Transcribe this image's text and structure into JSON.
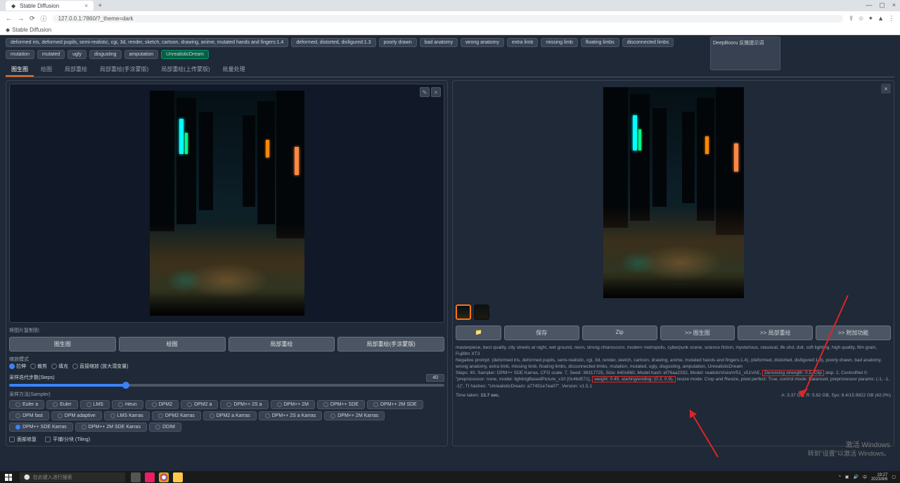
{
  "browser": {
    "tab_title": "Stable Diffusion",
    "url": "127.0.0.1:7860/?_theme=dark",
    "bookmark": "Stable Diffusion"
  },
  "deepbooru_label": "DeepBooru 反推提示词",
  "negative_chips_row1": [
    "deformed iris, deformed pupils, semi-realistic, cgi, 3d, render, sketch, cartoon, drawing, anime, mutated hands and fingers:1.4",
    "deformed, distorted, disfigured:1.3",
    "poorly drawn",
    "bad anatomy",
    "wrong anatomy",
    "extra limb",
    "missing limb",
    "floating limbs",
    "disconnected limbs"
  ],
  "negative_chips_row2": [
    "mutation",
    "mutated",
    "ugly",
    "disgusting",
    "amputation",
    "UnrealisticDream"
  ],
  "sub_tabs": [
    "图生图",
    "绘图",
    "局部重绘",
    "局部重绘(手涂蒙版)",
    "局部重绘(上传蒙版)",
    "批量处理"
  ],
  "left": {
    "copy_label": "将图片复制到:",
    "action_btns": [
      "图生图",
      "绘图",
      "局部重绘",
      "局部重绘(手涂蒙版)"
    ],
    "scale_label": "缩放模式",
    "scale_options": [
      "拉伸",
      "裁剪",
      "填充",
      "直接缩放 (放大潜变量)"
    ],
    "steps_label": "采样迭代步数(Steps)",
    "steps_value": "40",
    "sampler_label": "采样方法(Sampler)",
    "samplers": [
      "Euler a",
      "Euler",
      "LMS",
      "Heun",
      "DPM2",
      "DPM2 a",
      "DPM++ 2S a",
      "DPM++ 2M",
      "DPM++ SDE",
      "DPM++ 2M SDE",
      "DPM fast",
      "DPM adaptive",
      "LMS Karras",
      "DPM2 Karras",
      "DPM2 a Karras",
      "DPM++ 2S a Karras",
      "DPM++ 2M Karras",
      "DPM++ SDE Karras",
      "DPM++ 2M SDE Karras",
      "DDIM"
    ],
    "selected_sampler": "DPM++ SDE Karras",
    "check1": "面部修复",
    "check2": "平铺/分块 (Tiling)"
  },
  "right": {
    "btns": [
      "📁",
      "保存",
      "Zip",
      ">> 图生图",
      ">> 局部重绘",
      ">> 附加功能"
    ],
    "prompt": "masterpiece, best quality, city streets at night, wet ground, neon, strong chiaroscuro, modern metropolis, cyberpunk scene, science fiction, mysterious, classical, 8k uhd, dslr, soft lighting, high quality, film grain, Fujifilm XT3",
    "neg_prompt_label": "Negative prompt:",
    "neg_prompt": "(deformed iris, deformed pupils, semi-realistic, cgi, 3d, render, sketch, cartoon, drawing, anime, mutated hands and fingers:1.4), (deformed, distorted, disfigured:1.3), poorly drawn, bad anatomy, wrong anatomy, extra limb, missing limb, floating limbs, disconnected limbs, mutation, mutated, ugly, disgusting, amputation, UnrealisticDream",
    "params_before_hl1": "Steps: 40, Sampler: DPM++ SDE Karras, CFG scale: 7, Seed: 38317725, Size: 640x960, Model hash: ef76aa2332, Model: realisticVisionV51_v51VAE, ",
    "hl1": "Denoising strength: 0.5, Clip",
    "params_mid": " skip: 2, ControlNet 0: \"preprocessor: none, model: lightingBasedPicture_v10 [0c4bd571], ",
    "hl2": "weight: 0.45, starting/ending: (0.2, 0.9),",
    "params_after": " resize mode: Crop and Resize, pixel perfect: True, control mode: Balanced, preprocessor params: (-1, -1, -1)\", TI hashes: \"UnrealisticDream: a77451e7ea07\", Version: v1.5.1",
    "time_label": "Time taken:",
    "time_value": "13.7 sec.",
    "mem_info": "A: 3.37 GB, R: 5.62 GB, Sys: 6.4/15.9922 GB (42.0%)"
  },
  "watermark": {
    "line1": "激活 Windows",
    "line2": "转到\"设置\"以激活 Windows。"
  },
  "taskbar": {
    "search_placeholder": "在此键入进行搜索",
    "time": "19:27",
    "date": "2023/8/6"
  }
}
